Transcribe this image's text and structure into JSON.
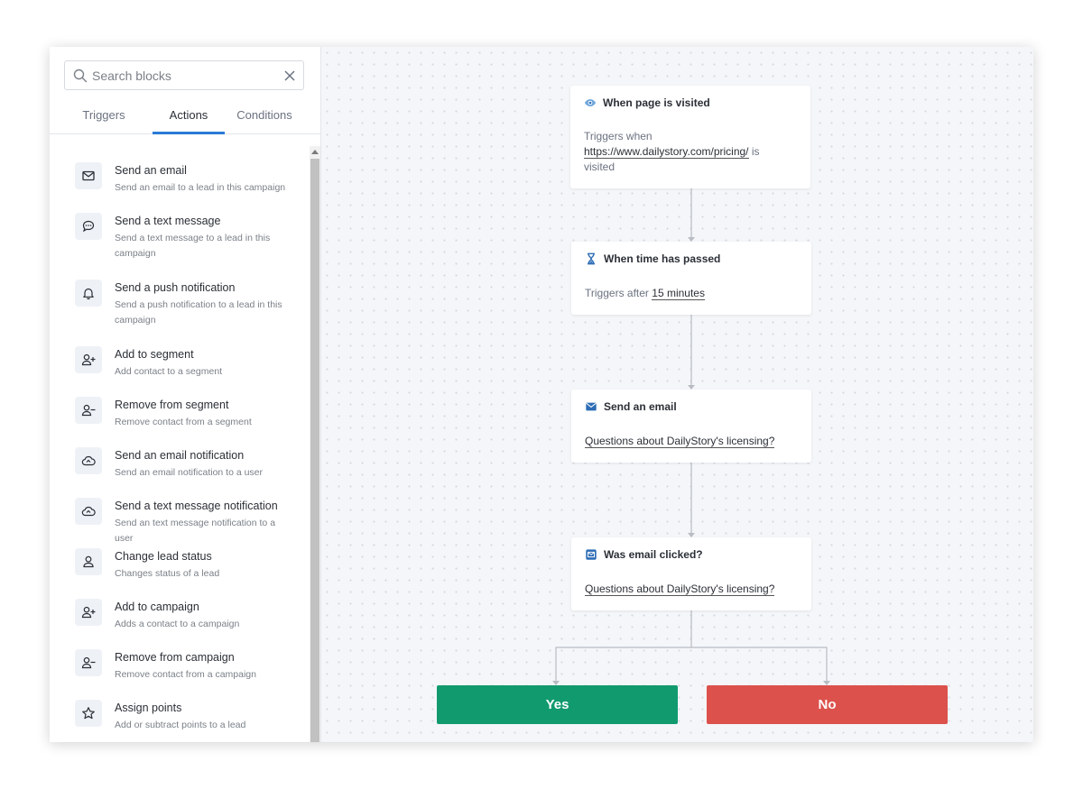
{
  "search": {
    "placeholder": "Search blocks",
    "value": ""
  },
  "tabs": [
    {
      "label": "Triggers",
      "active": false
    },
    {
      "label": "Actions",
      "active": true
    },
    {
      "label": "Conditions",
      "active": false
    }
  ],
  "actions": [
    {
      "title": "Send an email",
      "desc": "Send an email to a lead in this campaign",
      "icon": "envelope-icon"
    },
    {
      "title": "Send a text message",
      "desc": "Send a text message to a lead in this campaign",
      "icon": "chat-bubble-icon"
    },
    {
      "title": "Send a push notification",
      "desc": "Send a push notification to a lead in this campaign",
      "icon": "bell-icon"
    },
    {
      "title": "Add to segment",
      "desc": "Add contact to a segment",
      "icon": "user-plus-icon"
    },
    {
      "title": "Remove from segment",
      "desc": "Remove contact from a segment",
      "icon": "user-minus-icon"
    },
    {
      "title": "Send an email notification",
      "desc": "Send an email notification to a user",
      "icon": "cloud-icon"
    },
    {
      "title": "Send a text message notification",
      "desc": "Send an text message notification to a user",
      "icon": "cloud-icon"
    },
    {
      "title": "Change lead status",
      "desc": "Changes status of a lead",
      "icon": "user-icon"
    },
    {
      "title": "Add to campaign",
      "desc": "Adds a contact to a campaign",
      "icon": "user-plus-icon"
    },
    {
      "title": "Remove from campaign",
      "desc": "Remove contact from a campaign",
      "icon": "user-minus-icon"
    },
    {
      "title": "Assign points",
      "desc": "Add or subtract points to a lead",
      "icon": "star-icon"
    }
  ],
  "flow": {
    "page_visited": {
      "title": "When page is visited",
      "text_before": "Triggers when",
      "url": "https://www.dailystory.com/pricing/",
      "text_after": "is visited"
    },
    "time_passed": {
      "title": "When time has passed",
      "text_before": "Triggers after",
      "duration": "15 minutes"
    },
    "send_email": {
      "title": "Send an email",
      "subject": "Questions about DailyStory's licensing?"
    },
    "email_clicked": {
      "title": "Was email clicked?",
      "subject": "Questions about DailyStory's licensing?"
    },
    "yes_label": "Yes",
    "no_label": "No"
  },
  "colors": {
    "accent": "#2a7bd6",
    "yes": "#119a6e",
    "no": "#dc514c",
    "icon_blue": "#2d6db5"
  }
}
